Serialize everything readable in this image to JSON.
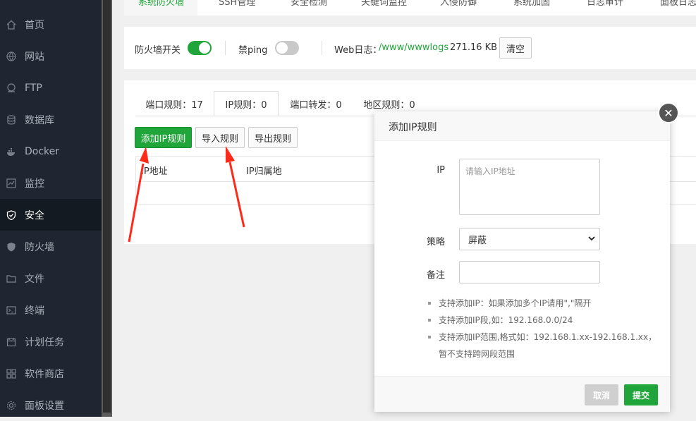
{
  "sidebar": {
    "items": [
      {
        "label": "首页",
        "icon": "home-icon"
      },
      {
        "label": "网站",
        "icon": "globe-icon"
      },
      {
        "label": "FTP",
        "icon": "ftp-icon"
      },
      {
        "label": "数据库",
        "icon": "database-icon"
      },
      {
        "label": "Docker",
        "icon": "docker-icon"
      },
      {
        "label": "监控",
        "icon": "monitor-icon"
      },
      {
        "label": "安全",
        "icon": "shield-check-icon"
      },
      {
        "label": "防火墙",
        "icon": "firewall-shield-icon"
      },
      {
        "label": "文件",
        "icon": "folder-icon"
      },
      {
        "label": "终端",
        "icon": "terminal-icon"
      },
      {
        "label": "计划任务",
        "icon": "calendar-icon"
      },
      {
        "label": "软件商店",
        "icon": "grid-icon"
      },
      {
        "label": "面板设置",
        "icon": "gear-icon"
      }
    ],
    "active": "安全"
  },
  "top_tabs": [
    "系统防火墙",
    "SSH管理",
    "安全检测",
    "关键词监控",
    "入侵防御",
    "系统加固",
    "日志审计",
    "面板日志"
  ],
  "switches": {
    "firewall_label": "防火墙开关",
    "firewall_on": true,
    "ping_label": "禁ping",
    "ping_on": false,
    "weblog_label": "Web日志：",
    "weblog_path": "/www/wwwlogs",
    "weblog_size": "271.16 KB",
    "clear_button": "清空"
  },
  "rule_tabs": [
    {
      "label": "端口规则：17"
    },
    {
      "label": "IP规则：0"
    },
    {
      "label": "端口转发：0"
    },
    {
      "label": "地区规则：0"
    }
  ],
  "actions": {
    "add_ip_rule": "添加IP规则",
    "import_rules": "导入规则",
    "export_rules": "导出规则"
  },
  "table": {
    "columns": [
      "IP地址",
      "IP归属地"
    ]
  },
  "modal": {
    "title": "添加IP规则",
    "ip_label": "IP",
    "ip_placeholder": "请输入IP地址",
    "policy_label": "策略",
    "policy_value": "屏蔽",
    "note_label": "备注",
    "tips": [
      "支持添加IP：如果添加多个IP请用\",\"隔开",
      "支持添加IP段,如：192.168.0.0/24",
      "支持添加IP范围,格式如：192.168.1.xx-192.168.1.xx，暂不支持跨网段范围"
    ],
    "cancel": "取消",
    "submit": "提交"
  },
  "colors": {
    "accent": "#20a53a",
    "sidebar_bg": "#1f2631",
    "annotation_arrow": "#ff2a1a"
  }
}
